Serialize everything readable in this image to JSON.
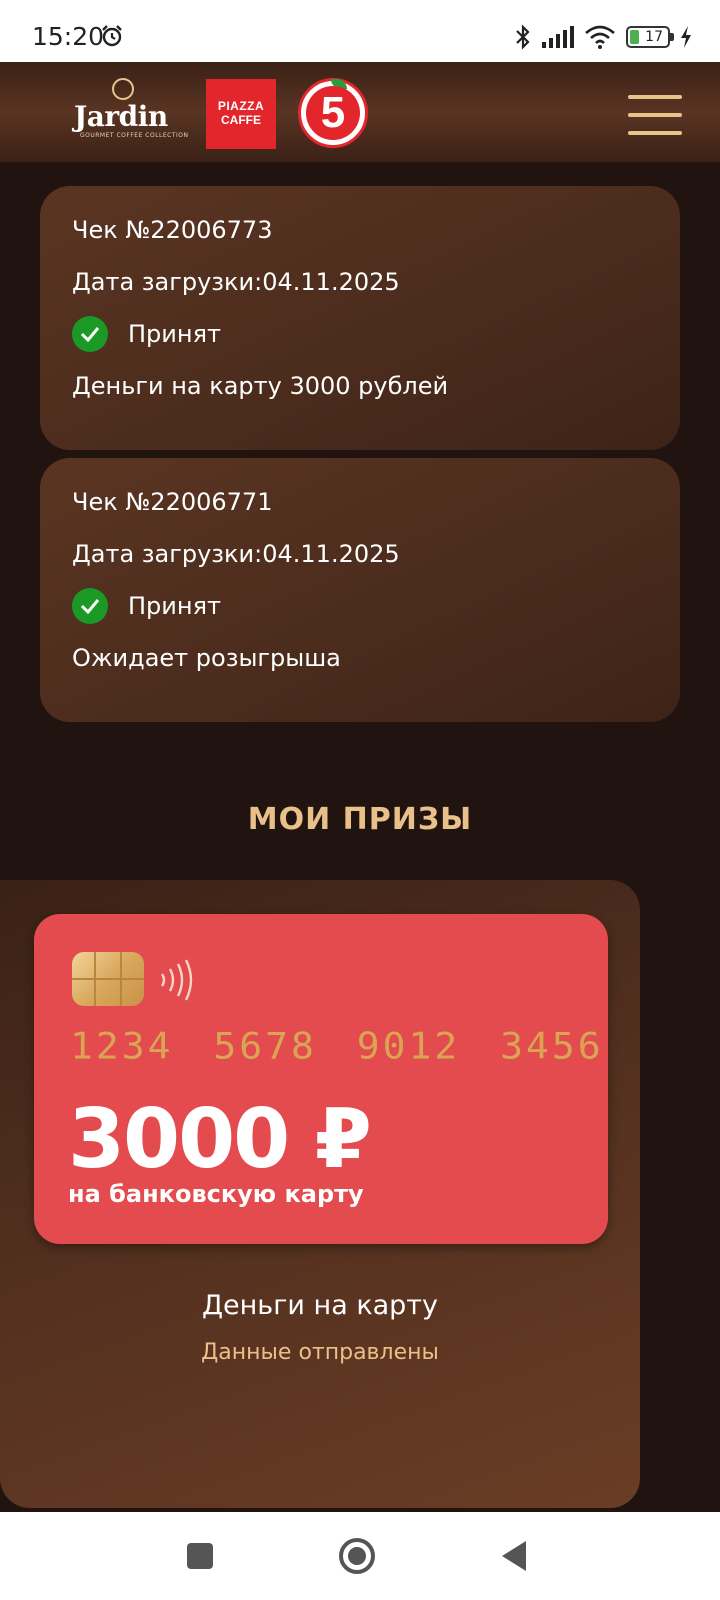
{
  "status_bar": {
    "time": "15:20",
    "battery_level": "17"
  },
  "header": {
    "logos": [
      "jardin-logo",
      "piazza-del-caffe-logo",
      "pyaterochka-logo"
    ],
    "jardin_text": "Jardin",
    "jardin_sub": "GOURMET COFFEE COLLECTION",
    "piazza_line1": "PIAZZA",
    "piazza_line2": "CAFFE",
    "five_text": "5",
    "menu_icon": "hamburger-menu-icon",
    "accent": "#e8c48b"
  },
  "checks": [
    {
      "number": "Чек №22006773",
      "upload_date": "Дата загрузки:04.11.2025",
      "status": "Принят",
      "result": "Деньги на карту 3000 рублей"
    },
    {
      "number": "Чек №22006771",
      "upload_date": "Дата загрузки:04.11.2025",
      "status": "Принят",
      "result": "Ожидает розыгрыша"
    }
  ],
  "prizes": {
    "title": "МОИ ПРИЗЫ",
    "card": {
      "number": "1234 5678 9012 3456",
      "amount": "3000 ₽",
      "caption": "на банковскую карту",
      "color": "#e44b4f"
    },
    "name": "Деньги на карту",
    "status": "Данные отправлены"
  },
  "colors": {
    "background": "#211410",
    "accent_gold": "#eac08a",
    "status_ok": "#1a9a25"
  }
}
